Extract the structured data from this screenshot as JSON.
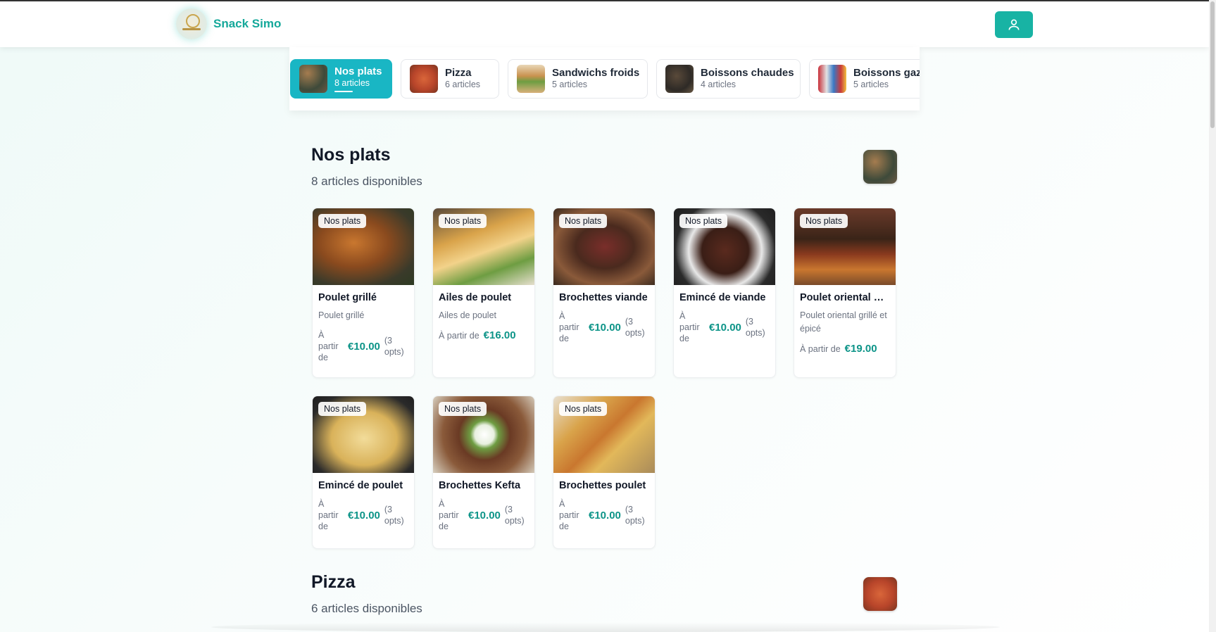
{
  "header": {
    "brand": "Snack Simo"
  },
  "categories": [
    {
      "name": "Nos plats",
      "count": "8 articles"
    },
    {
      "name": "Pizza",
      "count": "6 articles"
    },
    {
      "name": "Sandwichs froids",
      "count": "5 articles"
    },
    {
      "name": "Boissons chaudes",
      "count": "4 articles"
    },
    {
      "name": "Boissons gazeuses",
      "count": "5 articles"
    }
  ],
  "sections": [
    {
      "title": "Nos plats",
      "subtitle": "8 articles disponibles"
    },
    {
      "title": "Pizza",
      "subtitle": "6 articles disponibles"
    }
  ],
  "items": [
    {
      "badge": "Nos plats",
      "title": "Poulet grillé",
      "desc": "Poulet grillé",
      "price_label": "À partir de",
      "price": "€10.00",
      "opts": "(3 opts)"
    },
    {
      "badge": "Nos plats",
      "title": "Ailes de poulet",
      "desc": "Ailes de poulet",
      "price_label": "À partir de",
      "price": "€16.00",
      "opts": ""
    },
    {
      "badge": "Nos plats",
      "title": "Brochettes viande",
      "desc": "",
      "price_label": "À partir de",
      "price": "€10.00",
      "opts": "(3 opts)"
    },
    {
      "badge": "Nos plats",
      "title": "Emincé de viande",
      "desc": "",
      "price_label": "À partir de",
      "price": "€10.00",
      "opts": "(3 opts)"
    },
    {
      "badge": "Nos plats",
      "title": "Poulet oriental gri...",
      "desc": "Poulet oriental grillé et épicé",
      "price_label": "À partir de",
      "price": "€19.00",
      "opts": ""
    },
    {
      "badge": "Nos plats",
      "title": "Emincé de poulet",
      "desc": "",
      "price_label": "À partir de",
      "price": "€10.00",
      "opts": "(3 opts)"
    },
    {
      "badge": "Nos plats",
      "title": "Brochettes Kefta",
      "desc": "",
      "price_label": "À partir de",
      "price": "€10.00",
      "opts": "(3 opts)"
    },
    {
      "badge": "Nos plats",
      "title": "Brochettes poulet",
      "desc": "",
      "price_label": "À partir de",
      "price": "€10.00",
      "opts": "(3 opts)"
    }
  ],
  "colors": {
    "accent": "#18b3a4",
    "price": "#0d9488",
    "active_tab": "#19b6c4"
  }
}
